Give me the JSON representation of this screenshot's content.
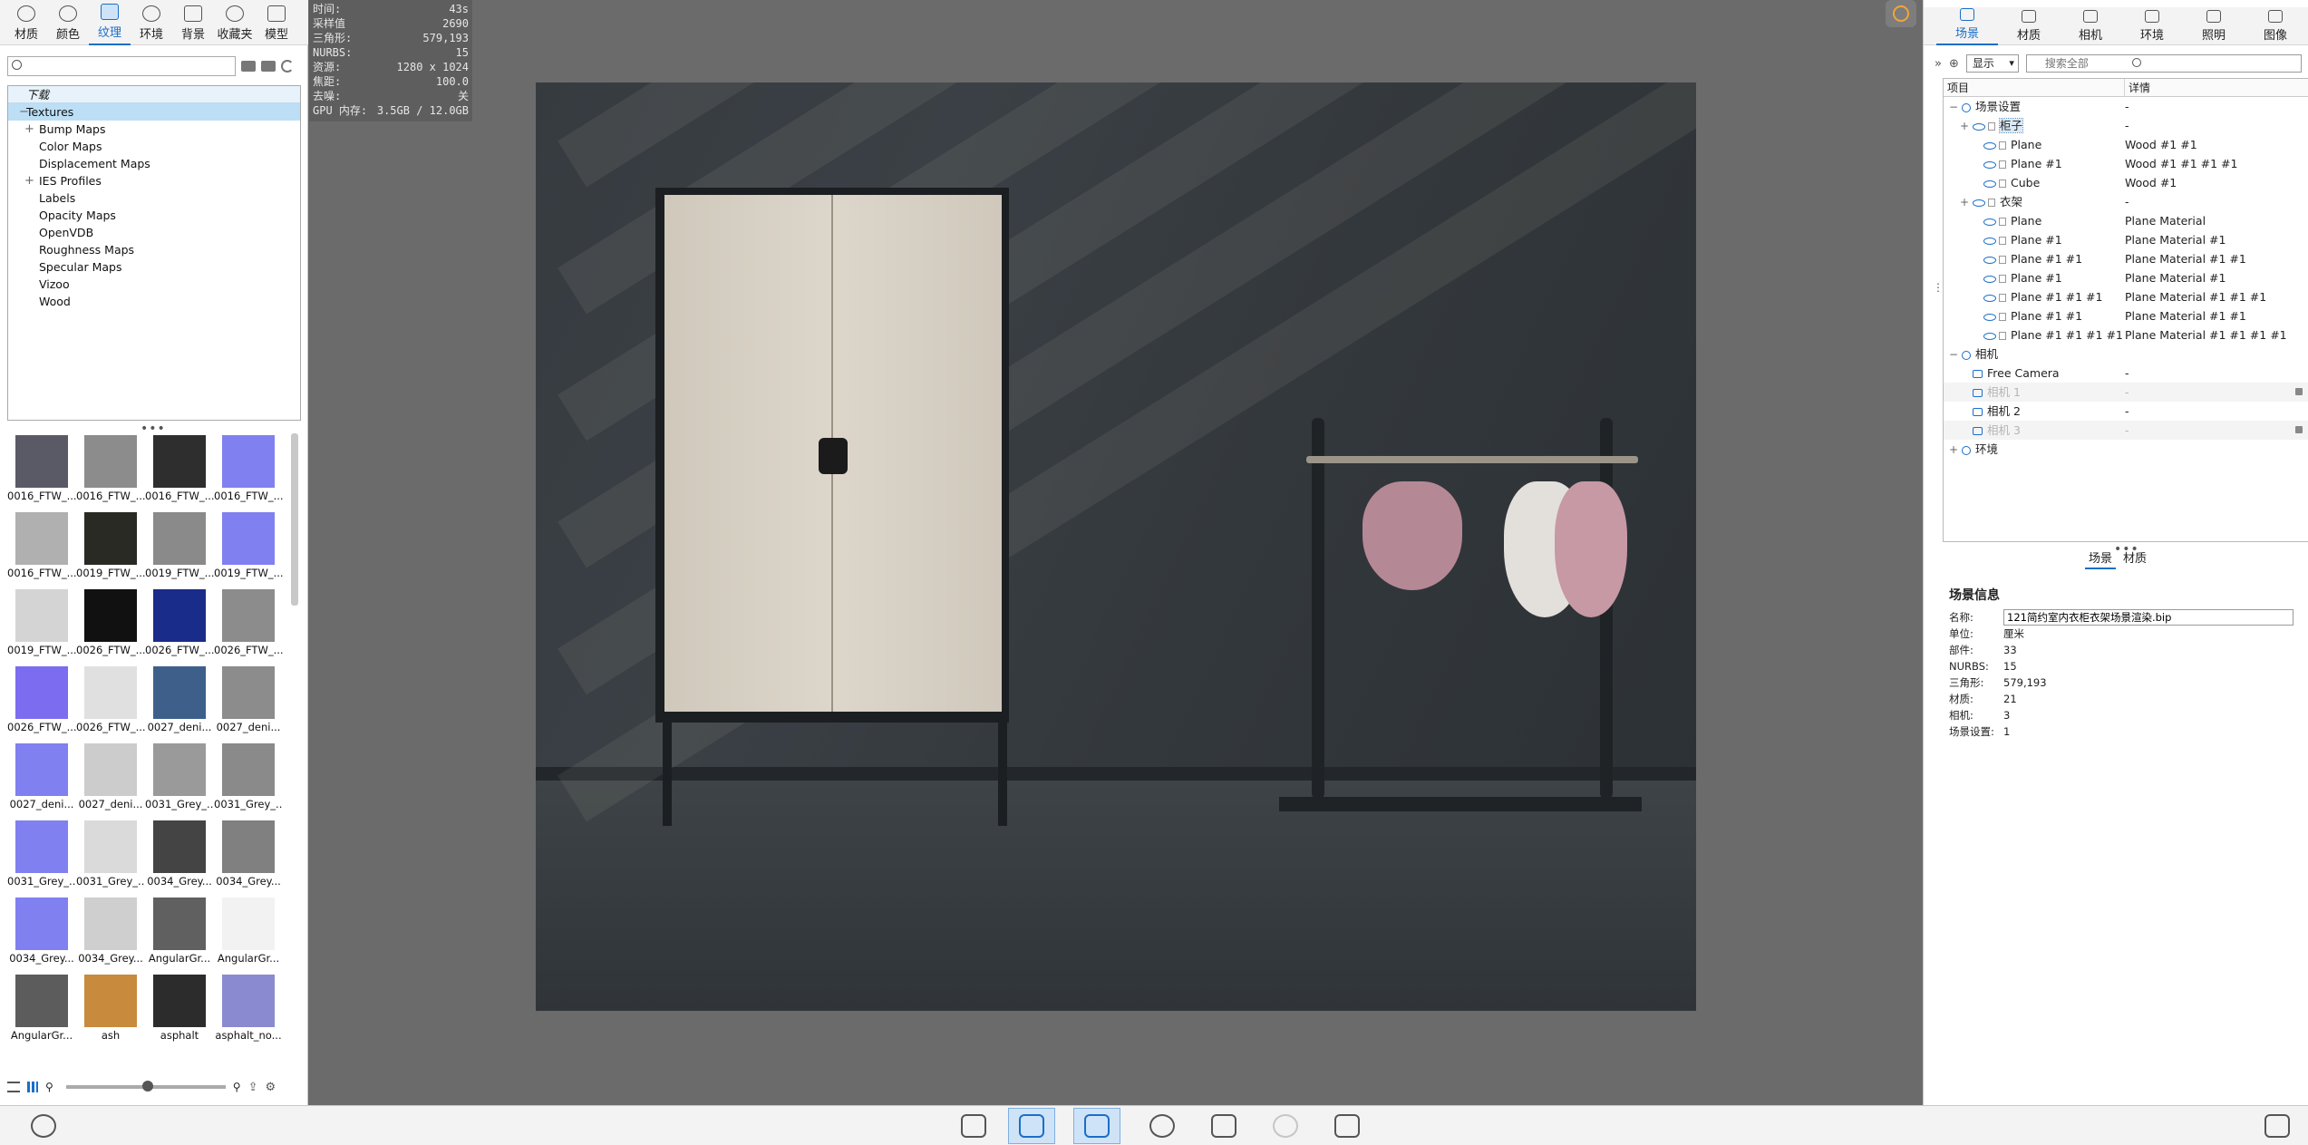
{
  "left_tabs": [
    {
      "label": "材质",
      "icon": "material-sphere-icon"
    },
    {
      "label": "颜色",
      "icon": "color-swatch-icon"
    },
    {
      "label": "纹理",
      "icon": "texture-icon",
      "active": true
    },
    {
      "label": "环境",
      "icon": "environment-globe-icon"
    },
    {
      "label": "背景",
      "icon": "background-image-icon"
    },
    {
      "label": "收藏夹",
      "icon": "favorites-star-icon"
    },
    {
      "label": "模型",
      "icon": "model-icon"
    }
  ],
  "texture_search": {
    "placeholder": "",
    "value": ""
  },
  "tree": {
    "first_item": "下载",
    "root": "Textures",
    "children": [
      {
        "label": "Bump Maps",
        "expandable": true
      },
      {
        "label": "Color Maps",
        "expandable": false
      },
      {
        "label": "Displacement Maps",
        "expandable": false
      },
      {
        "label": "IES Profiles",
        "expandable": true
      },
      {
        "label": "Labels",
        "expandable": false
      },
      {
        "label": "Opacity Maps",
        "expandable": false
      },
      {
        "label": "OpenVDB",
        "expandable": false
      },
      {
        "label": "Roughness Maps",
        "expandable": false
      },
      {
        "label": "Specular Maps",
        "expandable": false
      },
      {
        "label": "Vizoo",
        "expandable": false
      },
      {
        "label": "Wood",
        "expandable": false
      }
    ]
  },
  "thumbnails": [
    {
      "label": "0016_FTW_...",
      "color": "#5a5a66"
    },
    {
      "label": "0016_FTW_...",
      "color": "#8c8c8c"
    },
    {
      "label": "0016_FTW_...",
      "color": "#2e2e2e"
    },
    {
      "label": "0016_FTW_...",
      "color": "#8080f0"
    },
    {
      "label": "0016_FTW_...",
      "color": "#b0b0b0"
    },
    {
      "label": "0019_FTW_...",
      "color": "#2a2a24"
    },
    {
      "label": "0019_FTW_...",
      "color": "#8a8a8a"
    },
    {
      "label": "0019_FTW_...",
      "color": "#8080f0"
    },
    {
      "label": "0019_FTW_...",
      "color": "#d4d4d4"
    },
    {
      "label": "0026_FTW_...",
      "color": "#111111"
    },
    {
      "label": "0026_FTW_...",
      "color": "#1a2c8a"
    },
    {
      "label": "0026_FTW_...",
      "color": "#8c8c8c"
    },
    {
      "label": "0026_FTW_...",
      "color": "#7c6cf0"
    },
    {
      "label": "0026_FTW_...",
      "color": "#e0e0e0"
    },
    {
      "label": "0027_deni...",
      "color": "#3e5f8a"
    },
    {
      "label": "0027_deni...",
      "color": "#8c8c8c"
    },
    {
      "label": "0027_deni...",
      "color": "#8080f0"
    },
    {
      "label": "0027_deni...",
      "color": "#cccccc"
    },
    {
      "label": "0031_Grey_...",
      "color": "#9a9a9a"
    },
    {
      "label": "0031_Grey_...",
      "color": "#8a8a8a"
    },
    {
      "label": "0031_Grey_...",
      "color": "#8080f0"
    },
    {
      "label": "0031_Grey_...",
      "color": "#dadada"
    },
    {
      "label": "0034_Grey...",
      "color": "#444444"
    },
    {
      "label": "0034_Grey...",
      "color": "#808080"
    },
    {
      "label": "0034_Grey...",
      "color": "#8080f0"
    },
    {
      "label": "0034_Grey...",
      "color": "#cfcfcf"
    },
    {
      "label": "AngularGr...",
      "color": "#606060"
    },
    {
      "label": "AngularGr...",
      "color": "#f2f2f2"
    },
    {
      "label": "AngularGr...",
      "color": "#5c5c5c"
    },
    {
      "label": "ash",
      "color": "#c88a3c"
    },
    {
      "label": "asphalt",
      "color": "#2c2c2c"
    },
    {
      "label": "asphalt_no...",
      "color": "#8a8ad0"
    }
  ],
  "hud": {
    "rows": [
      {
        "k": "时间:",
        "v": "43s"
      },
      {
        "k": "采样值",
        "v": "2690"
      },
      {
        "k": "三角形:",
        "v": "579,193"
      },
      {
        "k": "NURBS:",
        "v": "15"
      },
      {
        "k": "资源:",
        "v": "1280 x 1024"
      },
      {
        "k": "焦距:",
        "v": "100.0"
      },
      {
        "k": "去噪:",
        "v": "关"
      },
      {
        "k": "GPU 内存:",
        "v": "3.5GB / 12.0GB"
      }
    ]
  },
  "right_tabs": [
    {
      "label": "场景",
      "active": true
    },
    {
      "label": "材质"
    },
    {
      "label": "相机"
    },
    {
      "label": "环境"
    },
    {
      "label": "照明"
    },
    {
      "label": "图像"
    }
  ],
  "filter": {
    "display": "显示",
    "search_placeholder": "搜索全部"
  },
  "outliner": {
    "col1": "项目",
    "col2": "详情",
    "rows": [
      {
        "indent": 0,
        "exp": "−",
        "kind": "group",
        "name": "场景设置",
        "detail": "-"
      },
      {
        "indent": 1,
        "exp": "+",
        "kind": "eye",
        "name": "柜子",
        "detail": "-",
        "hl": true
      },
      {
        "indent": 2,
        "exp": "",
        "kind": "eye",
        "name": "Plane",
        "detail": "Wood #1 #1"
      },
      {
        "indent": 2,
        "exp": "",
        "kind": "eye",
        "name": "Plane #1",
        "detail": "Wood #1 #1 #1 #1"
      },
      {
        "indent": 2,
        "exp": "",
        "kind": "eye",
        "name": "Cube",
        "detail": "Wood #1"
      },
      {
        "indent": 1,
        "exp": "+",
        "kind": "eye",
        "name": "衣架",
        "detail": "-"
      },
      {
        "indent": 2,
        "exp": "",
        "kind": "eye",
        "name": "Plane",
        "detail": "Plane Material"
      },
      {
        "indent": 2,
        "exp": "",
        "kind": "eye",
        "name": "Plane #1",
        "detail": "Plane Material #1"
      },
      {
        "indent": 2,
        "exp": "",
        "kind": "eye",
        "name": "Plane #1 #1",
        "detail": "Plane Material #1 #1"
      },
      {
        "indent": 2,
        "exp": "",
        "kind": "eye",
        "name": "Plane #1",
        "detail": "Plane Material #1"
      },
      {
        "indent": 2,
        "exp": "",
        "kind": "eye",
        "name": "Plane #1 #1 #1",
        "detail": "Plane Material #1 #1 #1"
      },
      {
        "indent": 2,
        "exp": "",
        "kind": "eye",
        "name": "Plane #1 #1",
        "detail": "Plane Material #1 #1"
      },
      {
        "indent": 2,
        "exp": "",
        "kind": "eye",
        "name": "Plane #1 #1 #1 #1",
        "detail": "Plane Material #1 #1 #1 #1"
      },
      {
        "indent": 0,
        "exp": "−",
        "kind": "group",
        "name": "相机",
        "detail": ""
      },
      {
        "indent": 1,
        "exp": "",
        "kind": "cam",
        "name": "Free Camera",
        "detail": "-"
      },
      {
        "indent": 1,
        "exp": "",
        "kind": "cam",
        "name": "相机 1",
        "detail": "-",
        "dim": true,
        "lock": true
      },
      {
        "indent": 1,
        "exp": "",
        "kind": "cam",
        "name": "相机 2",
        "detail": "-"
      },
      {
        "indent": 1,
        "exp": "",
        "kind": "cam",
        "name": "相机 3",
        "detail": "-",
        "dim": true,
        "lock": true
      },
      {
        "indent": 0,
        "exp": "+",
        "kind": "group",
        "name": "环境",
        "detail": ""
      }
    ]
  },
  "right_subtabs": [
    {
      "label": "场景",
      "active": true
    },
    {
      "label": "材质"
    }
  ],
  "scene_info": {
    "title": "场景信息",
    "name_label": "名称:",
    "name_value": "121简约室内衣柜衣架场景渲染.bip",
    "rows": [
      {
        "k": "单位:",
        "v": "厘米"
      },
      {
        "k": "部件:",
        "v": "33"
      },
      {
        "k": "NURBS:",
        "v": "15"
      },
      {
        "k": "三角形:",
        "v": "579,193"
      },
      {
        "k": "材质:",
        "v": "21"
      },
      {
        "k": "相机:",
        "v": "3"
      },
      {
        "k": "场景设置:",
        "v": "1"
      }
    ]
  },
  "bottom_bar": {
    "buttons": [
      {
        "name": "add-geometry-button",
        "icon": "add-geometry-icon"
      },
      {
        "name": "library-button",
        "icon": "book-icon",
        "active": true
      },
      {
        "name": "project-button",
        "icon": "project-icon",
        "active": true
      },
      {
        "name": "render-button",
        "icon": "play-icon"
      },
      {
        "name": "model-button",
        "icon": "cube-icon"
      },
      {
        "name": "keyshotxr-button",
        "icon": "xr-icon",
        "disabled": true
      },
      {
        "name": "screenshot-button",
        "icon": "camera-icon"
      }
    ]
  }
}
